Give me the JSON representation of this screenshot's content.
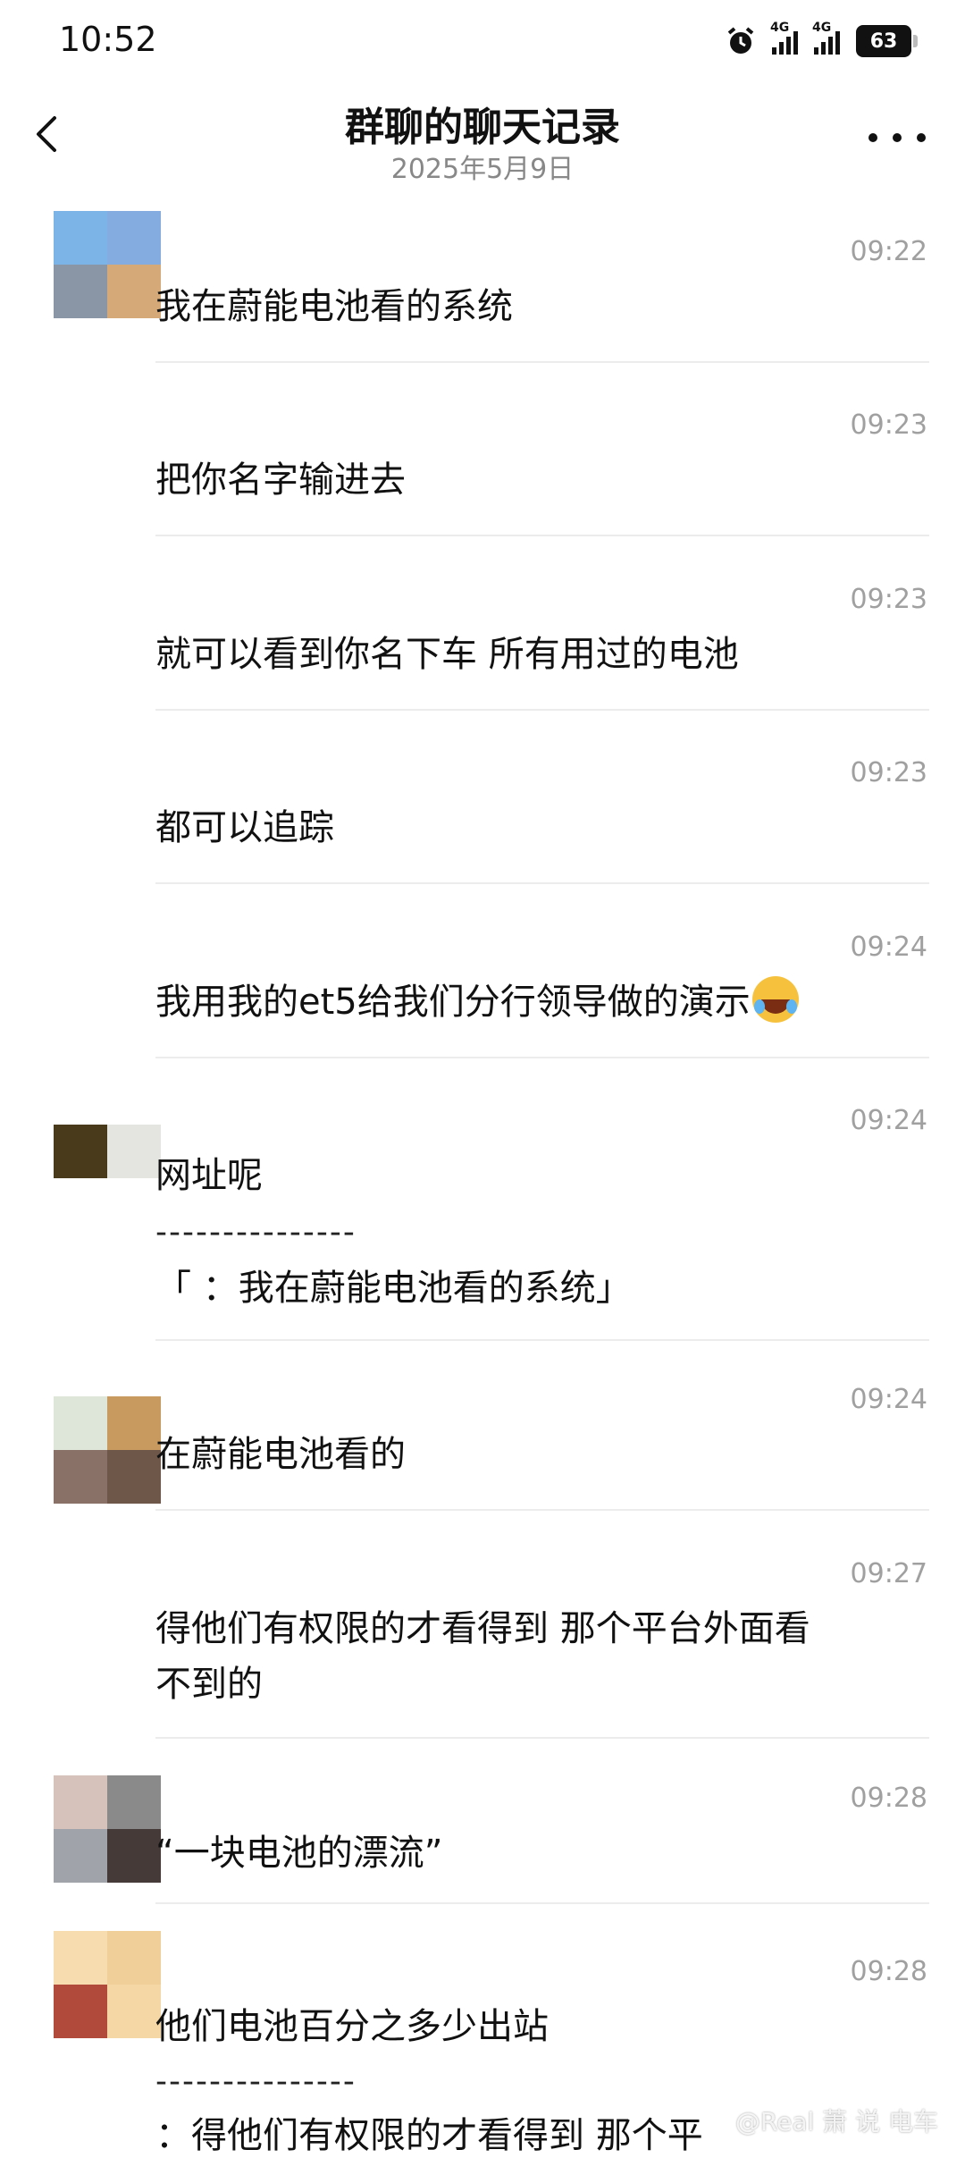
{
  "status_bar": {
    "time": "10:52",
    "network_1": "4G",
    "network_2": "4G",
    "battery": "63"
  },
  "header": {
    "title": "群聊的聊天记录",
    "date": "2025年5月9日"
  },
  "messages": [
    {
      "time": "09:22",
      "lines": [
        "我在蔚能电池看的系统"
      ]
    },
    {
      "time": "09:23",
      "lines": [
        "把你名字输进去"
      ]
    },
    {
      "time": "09:23",
      "lines": [
        "就可以看到你名下车 所有用过的电池"
      ]
    },
    {
      "time": "09:23",
      "lines": [
        "都可以追踪"
      ]
    },
    {
      "time": "09:24",
      "lines": [
        "我用我的et5给我们分行领导做的演示"
      ],
      "emoji": "tears-of-joy-emoji"
    },
    {
      "time": "09:24",
      "lines": [
        "网址呢"
      ],
      "quote_separator": "---------------",
      "quote": "「        ：我在蔚能电池看的系统」"
    },
    {
      "time": "09:24",
      "lines": [
        "在蔚能电池看的"
      ]
    },
    {
      "time": "09:27",
      "lines": [
        "得他们有权限的才看得到 那个平台外面看",
        "不到的"
      ]
    },
    {
      "time": "09:28",
      "lines": [
        "“一块电池的漂流”"
      ]
    },
    {
      "time": "09:28",
      "lines": [
        "他们电池百分之多少出站"
      ],
      "quote_separator": "---------------",
      "quote": "       ：得他们有权限的才看得到 那个平"
    }
  ],
  "watermark": "@Real 萧 说 电车",
  "colors": {
    "text": "#111111",
    "secondary": "#888888",
    "time": "#a0a0a0",
    "divider": "#ececec"
  }
}
